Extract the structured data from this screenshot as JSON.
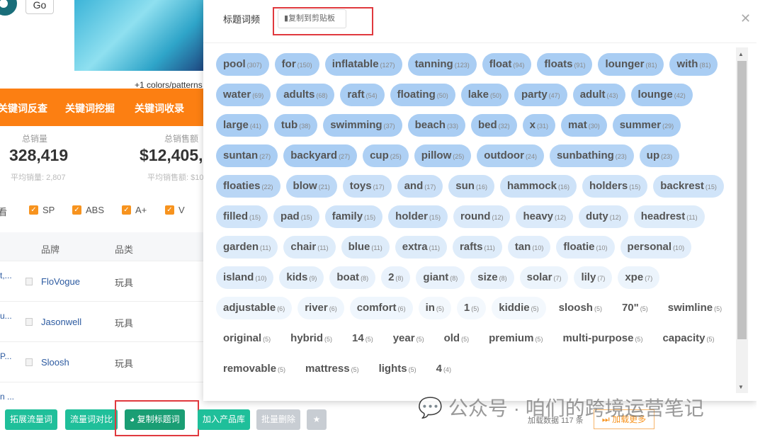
{
  "top": {
    "go_label": "Go",
    "colors_text": "+1 colors/patterns"
  },
  "orange_nav": [
    "关键词反查",
    "关键词挖掘",
    "关键词收录"
  ],
  "stats": [
    {
      "label": "总销量",
      "value": "328,419",
      "sub": "平均销量: 2,807"
    },
    {
      "label": "总销售额",
      "value": "$12,405,",
      "sub": "平均销售额: $10"
    }
  ],
  "filters": {
    "prefix": "看",
    "options": [
      "SP",
      "ABS",
      "A+",
      "V"
    ]
  },
  "table": {
    "headers": [
      "品牌",
      "品类"
    ],
    "rows": [
      {
        "title": "t,...",
        "brand": "FloVogue",
        "category": "玩具"
      },
      {
        "title": "u...",
        "brand": "Jasonwell",
        "category": "玩具"
      },
      {
        "title": "P...",
        "brand": "Sloosh",
        "category": "玩具"
      },
      {
        "title": "n ...",
        "brand": "",
        "category": ""
      }
    ]
  },
  "actions": {
    "expand": "拓展流量词",
    "compare": "流量词对比",
    "copy_title_words": "复制标题词",
    "add_library": "加入产品库",
    "batch_delete": "批量删除"
  },
  "footer": {
    "loaded": "加载数据 117 条",
    "load_more": "加载更多"
  },
  "watermark": "公众号 · 咱们的跨境运营笔记",
  "modal": {
    "title": "标题词频",
    "copy_label": "复制到剪贴板",
    "tag_color": "#a9cdf3",
    "tags": [
      [
        "pool",
        307
      ],
      [
        "for",
        150
      ],
      [
        "inflatable",
        127
      ],
      [
        "tanning",
        123
      ],
      [
        "float",
        94
      ],
      [
        "floats",
        91
      ],
      [
        "lounger",
        81
      ],
      [
        "with",
        81
      ],
      [
        "water",
        69
      ],
      [
        "adults",
        68
      ],
      [
        "raft",
        54
      ],
      [
        "floating",
        50
      ],
      [
        "lake",
        50
      ],
      [
        "party",
        47
      ],
      [
        "adult",
        43
      ],
      [
        "lounge",
        42
      ],
      [
        "large",
        41
      ],
      [
        "tub",
        38
      ],
      [
        "swimming",
        37
      ],
      [
        "beach",
        33
      ],
      [
        "bed",
        32
      ],
      [
        "x",
        31
      ],
      [
        "mat",
        30
      ],
      [
        "summer",
        29
      ],
      [
        "suntan",
        27
      ],
      [
        "backyard",
        27
      ],
      [
        "cup",
        25
      ],
      [
        "pillow",
        25
      ],
      [
        "outdoor",
        24
      ],
      [
        "sunbathing",
        23
      ],
      [
        "up",
        23
      ],
      [
        "floaties",
        22
      ],
      [
        "blow",
        21
      ],
      [
        "toys",
        17
      ],
      [
        "and",
        17
      ],
      [
        "sun",
        16
      ],
      [
        "hammock",
        16
      ],
      [
        "holders",
        15
      ],
      [
        "backrest",
        15
      ],
      [
        "filled",
        15
      ],
      [
        "pad",
        15
      ],
      [
        "family",
        15
      ],
      [
        "holder",
        15
      ],
      [
        "round",
        12
      ],
      [
        "heavy",
        12
      ],
      [
        "duty",
        12
      ],
      [
        "headrest",
        11
      ],
      [
        "garden",
        11
      ],
      [
        "chair",
        11
      ],
      [
        "blue",
        11
      ],
      [
        "extra",
        11
      ],
      [
        "rafts",
        11
      ],
      [
        "tan",
        10
      ],
      [
        "floatie",
        10
      ],
      [
        "personal",
        10
      ],
      [
        "island",
        10
      ],
      [
        "kids",
        9
      ],
      [
        "boat",
        8
      ],
      [
        "2",
        8
      ],
      [
        "giant",
        8
      ],
      [
        "size",
        8
      ],
      [
        "solar",
        7
      ],
      [
        "lily",
        7
      ],
      [
        "xpe",
        7
      ],
      [
        "adjustable",
        6
      ],
      [
        "river",
        6
      ],
      [
        "comfort",
        6
      ],
      [
        "in",
        5
      ],
      [
        "1",
        5
      ],
      [
        "kiddie",
        5
      ],
      [
        "sloosh",
        5
      ],
      [
        "70\"",
        5
      ],
      [
        "swimline",
        5
      ],
      [
        "original",
        5
      ],
      [
        "hybrid",
        5
      ],
      [
        "14",
        5
      ],
      [
        "year",
        5
      ],
      [
        "old",
        5
      ],
      [
        "premium",
        5
      ],
      [
        "multi-purpose",
        5
      ],
      [
        "capacity",
        5
      ],
      [
        "removable",
        5
      ],
      [
        "mattress",
        5
      ],
      [
        "lights",
        5
      ],
      [
        "4",
        4
      ]
    ]
  }
}
